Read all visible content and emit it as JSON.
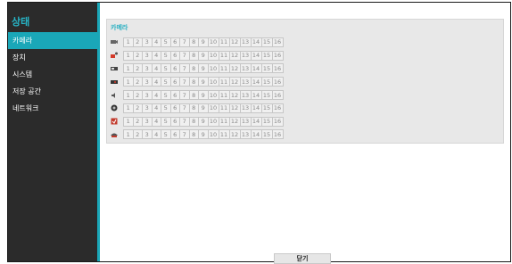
{
  "sidebar": {
    "title": "상태",
    "items": [
      {
        "label": "카메라",
        "active": true
      },
      {
        "label": "장치",
        "active": false
      },
      {
        "label": "시스템",
        "active": false
      },
      {
        "label": "저장 공간",
        "active": false
      },
      {
        "label": "네트워크",
        "active": false
      }
    ]
  },
  "main": {
    "section_title": "카메라",
    "rows": [
      {
        "icon": "camera-settings-icon"
      },
      {
        "icon": "motion-alert-icon"
      },
      {
        "icon": "video-loss-icon"
      },
      {
        "icon": "recording-icon"
      },
      {
        "icon": "audio-icon"
      },
      {
        "icon": "tamper-icon"
      },
      {
        "icon": "event-icon"
      },
      {
        "icon": "ptz-icon"
      }
    ],
    "channels": [
      "1",
      "2",
      "3",
      "4",
      "5",
      "6",
      "7",
      "8",
      "9",
      "10",
      "11",
      "12",
      "13",
      "14",
      "15",
      "16"
    ]
  },
  "footer": {
    "close_label": "닫기"
  },
  "colors": {
    "accent": "#1aa7b8",
    "sidebar_bg": "#2b2b2b",
    "panel_bg": "#e8e8e8"
  }
}
